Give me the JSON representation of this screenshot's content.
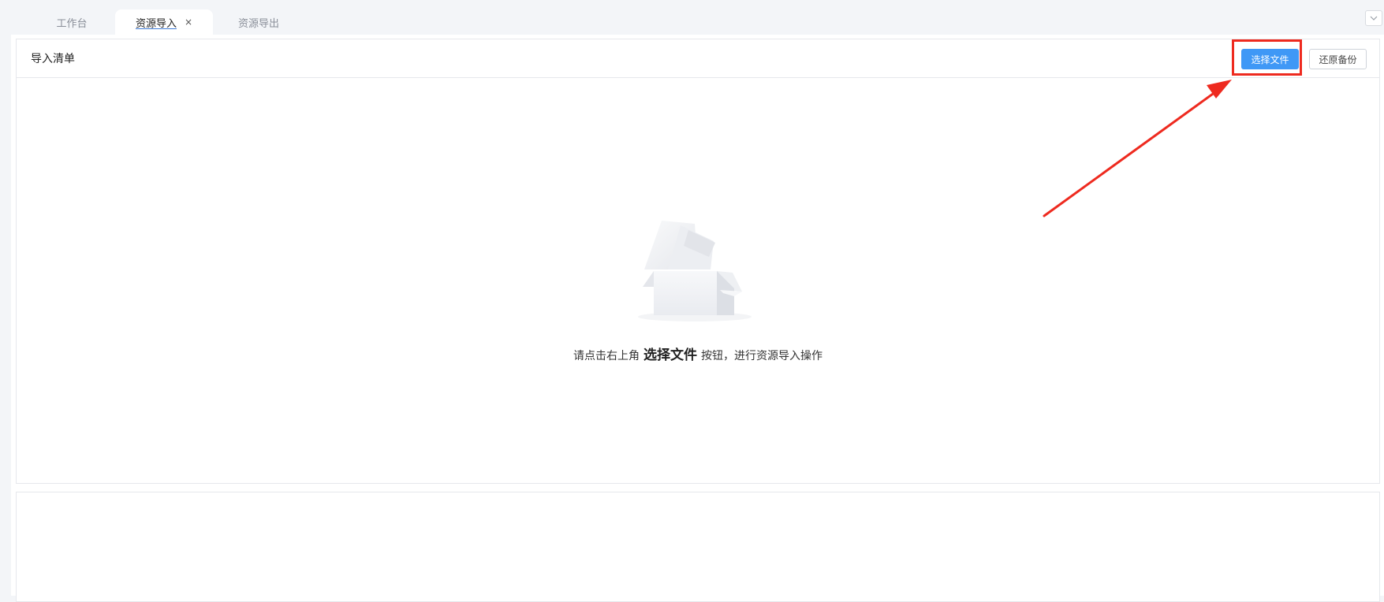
{
  "tabs": {
    "workbench": "工作台",
    "import": "资源导入",
    "import_close": "×",
    "export": "资源导出"
  },
  "panel": {
    "title": "导入清单",
    "select_button": "选择文件",
    "restore_button": "还原备份"
  },
  "empty": {
    "prefix": "请点击右上角",
    "emphasis": "选择文件",
    "suffix": "按钮，进行资源导入操作"
  },
  "icons": {
    "dropdown": "chevron-down-icon",
    "empty": "empty-box-icon",
    "annotation": "red-arrow-icon"
  },
  "colors": {
    "primary": "#3f98f6",
    "highlight": "#ee2a1f"
  }
}
